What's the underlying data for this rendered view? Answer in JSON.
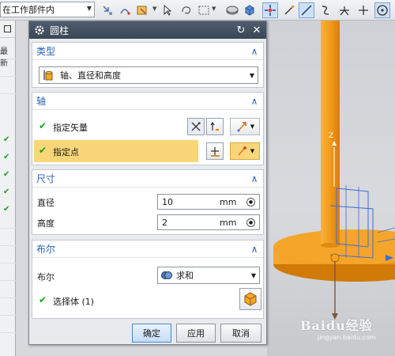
{
  "toolbar": {
    "filter_value": "在工作部件内"
  },
  "left_panel": {
    "column_label": "最新"
  },
  "dialog": {
    "title": "圆柱",
    "type_section": {
      "header": "类型",
      "selected": "轴、直径和高度"
    },
    "axis_section": {
      "header": "轴",
      "specify_vector": "指定矢量",
      "specify_point": "指定点"
    },
    "dimension_section": {
      "header": "尺寸",
      "diameter_label": "直径",
      "diameter_value": "10",
      "diameter_unit": "mm",
      "height_label": "高度",
      "height_value": "2",
      "height_unit": "mm"
    },
    "boolean_section": {
      "header": "布尔",
      "boolean_label": "布尔",
      "boolean_value": "求和",
      "select_body_label": "选择体 (1)"
    },
    "buttons": {
      "ok": "确定",
      "apply": "应用",
      "cancel": "取消"
    }
  },
  "viewport": {
    "axis_label": "Z",
    "part_color": "#f09a1a"
  },
  "watermark": {
    "main": "Baidu经验",
    "sub": "jingyan.baidu.com"
  },
  "colors": {
    "section_header": "#2a62b8",
    "highlight_row": "#f9d67a",
    "check_green": "#1aa01a"
  }
}
